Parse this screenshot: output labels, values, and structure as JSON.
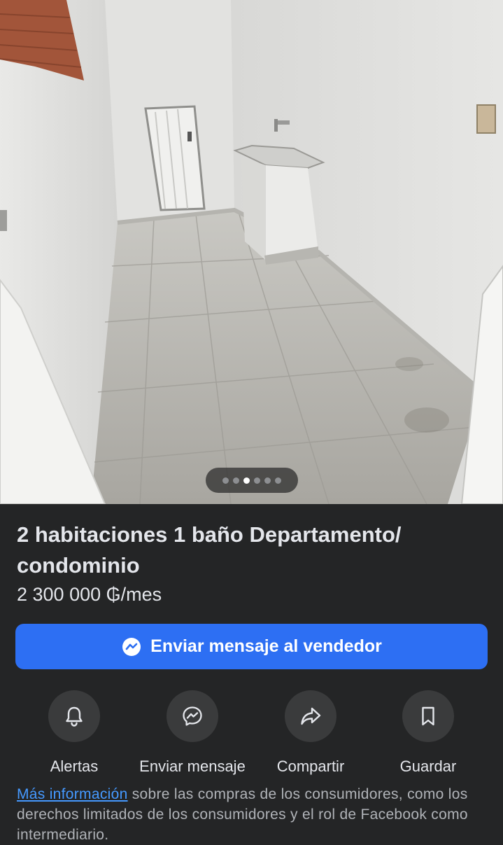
{
  "carousel": {
    "total": 6,
    "active_index": 2
  },
  "listing": {
    "title": "2 habitaciones 1 baño Departamento/ condominio",
    "price": "2 300 000 ₲/mes"
  },
  "primary_action": {
    "label": "Enviar mensaje al vendedor",
    "icon": "messenger-icon"
  },
  "actions": [
    {
      "label": "Alertas",
      "icon": "bell-icon"
    },
    {
      "label": "Enviar mensaje",
      "icon": "messenger-icon"
    },
    {
      "label": "Compartir",
      "icon": "share-icon"
    },
    {
      "label": "Guardar",
      "icon": "bookmark-icon"
    }
  ],
  "info": {
    "link_text": "Más información",
    "text": " sobre las compras de los consumidores, como los derechos limitados de los consumidores y el rol de Facebook como intermediario."
  },
  "colors": {
    "background": "#242526",
    "button": "#2d6ff3",
    "link": "#4599ff"
  }
}
